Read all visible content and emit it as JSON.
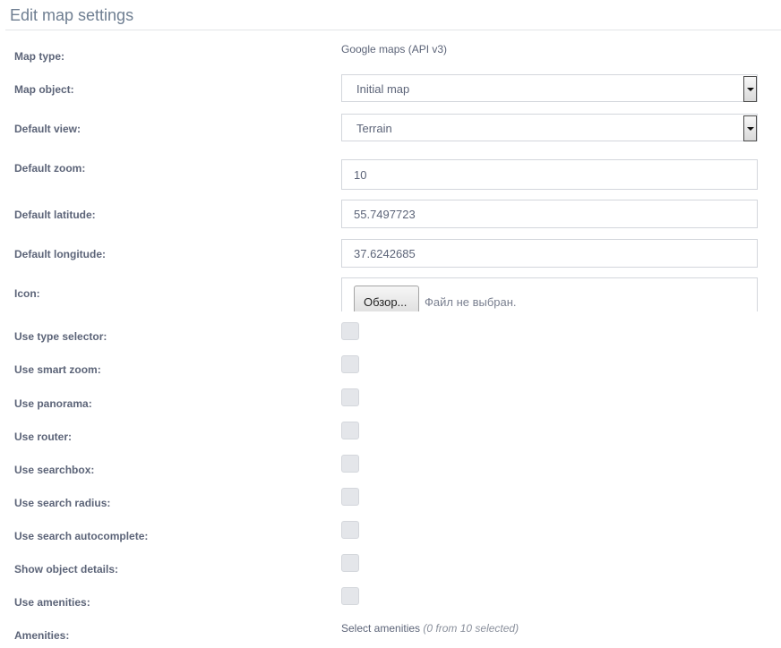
{
  "page": {
    "title": "Edit map settings"
  },
  "fields": {
    "map_type": {
      "label": "Map type:",
      "value": "Google maps (API v3)"
    },
    "map_object": {
      "label": "Map object:",
      "value": "Initial map"
    },
    "default_view": {
      "label": "Default view:",
      "value": "Terrain"
    },
    "default_zoom": {
      "label": "Default zoom:",
      "value": "10"
    },
    "default_latitude": {
      "label": "Default latitude:",
      "value": "55.7497723"
    },
    "default_longitude": {
      "label": "Default longitude:",
      "value": "37.6242685"
    },
    "icon": {
      "label": "Icon:",
      "button": "Обзор...",
      "status": "Файл не выбран."
    }
  },
  "checkboxes": {
    "use_type_selector": {
      "label": "Use type selector:",
      "checked": false
    },
    "use_smart_zoom": {
      "label": "Use smart zoom:",
      "checked": false
    },
    "use_panorama": {
      "label": "Use panorama:",
      "checked": false
    },
    "use_router": {
      "label": "Use router:",
      "checked": false
    },
    "use_searchbox": {
      "label": "Use searchbox:",
      "checked": false
    },
    "use_search_radius": {
      "label": "Use search radius:",
      "checked": false
    },
    "use_search_autocomplete": {
      "label": "Use search autocomplete:",
      "checked": false
    },
    "show_object_details": {
      "label": "Show object details:",
      "checked": false
    },
    "use_amenities": {
      "label": "Use amenities:",
      "checked": false
    }
  },
  "amenities": {
    "label": "Amenities:",
    "link": "Select amenities",
    "count": "(0 from 10 selected)"
  }
}
